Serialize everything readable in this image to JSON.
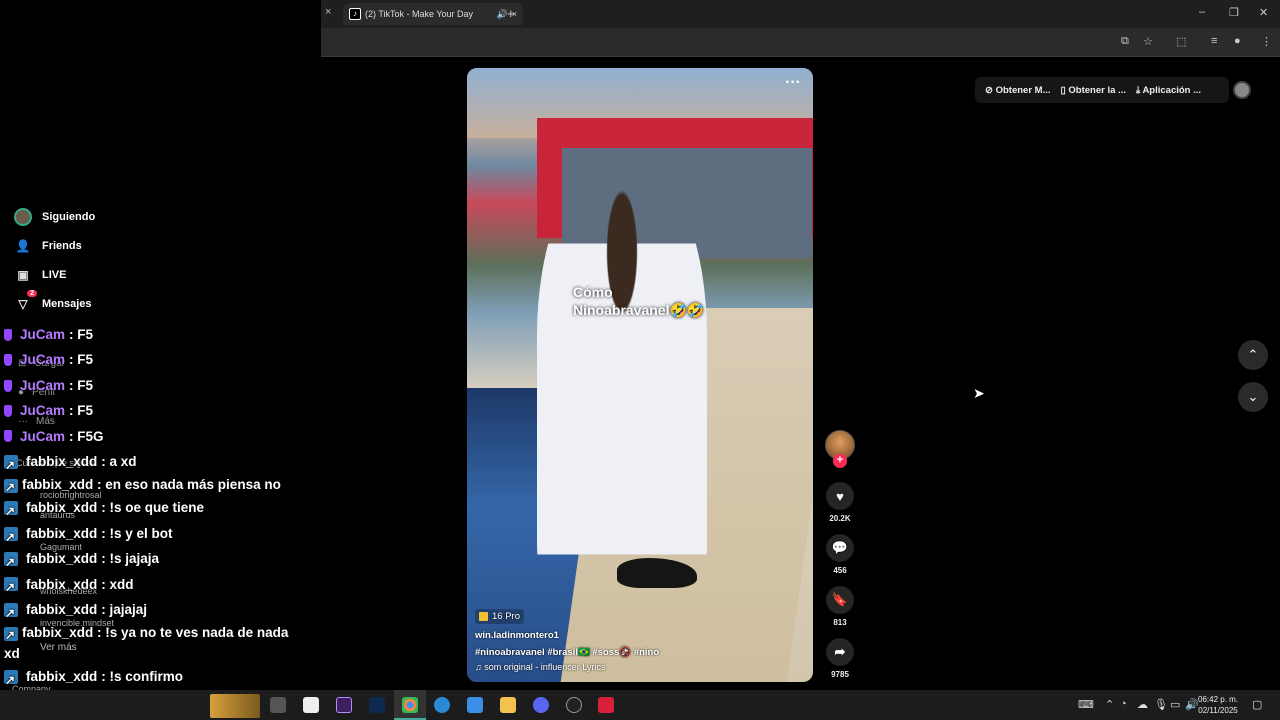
{
  "browser": {
    "tab_title": "(2) TikTok - Make Your Day",
    "tab_close": "×",
    "left_close": "×",
    "new_tab": "+",
    "win_min": "–",
    "win_restore": "❐",
    "win_close": "✕"
  },
  "top_actions": {
    "get_coins": "Obtener M...",
    "get_app": "Obtener la ...",
    "app": "Aplicación ..."
  },
  "sidebar": {
    "items": [
      {
        "label": "Siguiendo",
        "icon": "avatar-icon"
      },
      {
        "label": "Friends",
        "icon": "friends-icon"
      },
      {
        "label": "LIVE",
        "icon": "live-icon"
      },
      {
        "label": "Mensajes",
        "icon": "messages-icon",
        "badge": "2"
      }
    ],
    "dim_items": [
      "Cargar",
      "Perfil",
      "Más"
    ],
    "following_header": "Cuentas que sigues",
    "following": [
      "rociobrightrosal",
      "antaurus",
      "Gagumant",
      "whoiskhedeex",
      "invencible.mindset"
    ],
    "see_more": "Ver más",
    "company": "Company"
  },
  "chat": [
    {
      "name": "JuCam",
      "msg": " : F5",
      "color": "purple"
    },
    {
      "name": "JuCam",
      "msg": " : F5",
      "color": "purple"
    },
    {
      "name": "JuCam",
      "msg": " : F5",
      "color": "purple"
    },
    {
      "name": "JuCam",
      "msg": " : F5",
      "color": "purple"
    },
    {
      "name": "JuCam",
      "msg": " : F5G",
      "color": "purple"
    },
    {
      "name": "fabbix_xdd",
      "msg": " : a xd",
      "color": "white"
    },
    {
      "name": "fabbix_xdd",
      "msg": " : en eso nada más piensa no",
      "color": "white"
    },
    {
      "name": "fabbix_xdd",
      "msg": " : !s oe que tiene",
      "color": "white"
    },
    {
      "name": "fabbix_xdd",
      "msg": " : !s y el bot",
      "color": "white"
    },
    {
      "name": "fabbix_xdd",
      "msg": " : !s jajaja",
      "color": "white"
    },
    {
      "name": "fabbix_xdd",
      "msg": " : xdd",
      "color": "white"
    },
    {
      "name": "fabbix_xdd",
      "msg": " : jajajaj",
      "color": "white"
    },
    {
      "name": "fabbix_xdd",
      "msg": " : !s ya no te ves nada de nada xd",
      "color": "white"
    },
    {
      "name": "fabbix_xdd",
      "msg": " : !s confirmo",
      "color": "white"
    }
  ],
  "video": {
    "more": "···",
    "overlay_line1": "Cómo",
    "overlay_line2": "Ninoabravanel🤣🤣",
    "promo": "16 Pro",
    "author": "win.ladinmontero1",
    "tags": "#ninoabravanel  #brasil🇧🇷  #soss🚱  #nino",
    "sound": "♫  som original - influencer Lyrics"
  },
  "actions": {
    "likes": "20.2K",
    "comments": "456",
    "saves": "813",
    "shares": "9785"
  },
  "taskbar": {
    "time": "06:42 p. m.",
    "date": "02/11/2025"
  },
  "colors": {
    "accent": "#fe2c55",
    "chat_purple": "#b57bff"
  }
}
